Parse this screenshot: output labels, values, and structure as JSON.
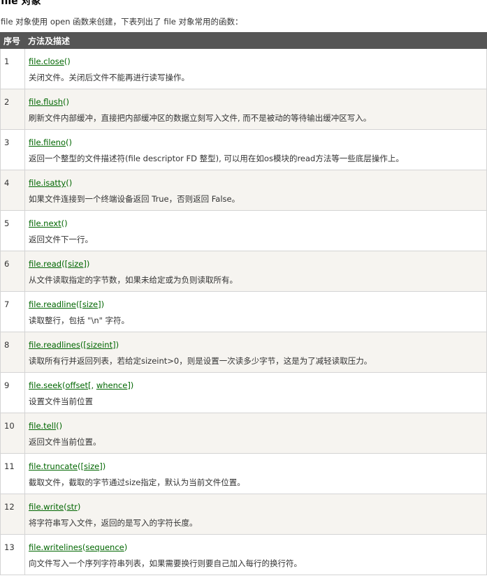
{
  "page": {
    "heading": "file 对象",
    "intro": "file 对象使用 open 函数来创建，下表列出了 file 对象常用的函数："
  },
  "table": {
    "headers": [
      "序号",
      "方法及描述"
    ],
    "rows": [
      {
        "num": "1",
        "parts": [
          {
            "t": "file.close",
            "u": true
          },
          {
            "t": "()",
            "u": false
          }
        ],
        "desc": "关闭文件。关闭后文件不能再进行读写操作。"
      },
      {
        "num": "2",
        "parts": [
          {
            "t": "file.flush",
            "u": true
          },
          {
            "t": "()",
            "u": false
          }
        ],
        "desc": "刷新文件内部缓冲，直接把内部缓冲区的数据立刻写入文件, 而不是被动的等待输出缓冲区写入。"
      },
      {
        "num": "3",
        "parts": [
          {
            "t": "file.fileno",
            "u": true
          },
          {
            "t": "()",
            "u": false
          }
        ],
        "desc": "返回一个整型的文件描述符(file descriptor FD 整型), 可以用在如os模块的read方法等一些底层操作上。"
      },
      {
        "num": "4",
        "parts": [
          {
            "t": "file.isatty",
            "u": true
          },
          {
            "t": "()",
            "u": false
          }
        ],
        "desc": "如果文件连接到一个终端设备返回 True，否则返回 False。"
      },
      {
        "num": "5",
        "parts": [
          {
            "t": "file.next",
            "u": true
          },
          {
            "t": "()",
            "u": false
          }
        ],
        "desc": "返回文件下一行。"
      },
      {
        "num": "6",
        "parts": [
          {
            "t": "file.read",
            "u": true
          },
          {
            "t": "([",
            "u": false
          },
          {
            "t": "size",
            "u": true
          },
          {
            "t": "])",
            "u": false
          }
        ],
        "desc": "从文件读取指定的字节数，如果未给定或为负则读取所有。"
      },
      {
        "num": "7",
        "parts": [
          {
            "t": "file.readline",
            "u": true
          },
          {
            "t": "([",
            "u": false
          },
          {
            "t": "size",
            "u": true
          },
          {
            "t": "])",
            "u": false
          }
        ],
        "desc": "读取整行，包括 \"\\n\" 字符。"
      },
      {
        "num": "8",
        "parts": [
          {
            "t": "file.readlines",
            "u": true
          },
          {
            "t": "([",
            "u": false
          },
          {
            "t": "sizeint",
            "u": true
          },
          {
            "t": "])",
            "u": false
          }
        ],
        "desc": "读取所有行并返回列表，若给定sizeint>0，则是设置一次读多少字节，这是为了减轻读取压力。"
      },
      {
        "num": "9",
        "parts": [
          {
            "t": "file.seek",
            "u": true
          },
          {
            "t": "(",
            "u": false
          },
          {
            "t": "offset",
            "u": true
          },
          {
            "t": "[, ",
            "u": false
          },
          {
            "t": "whence",
            "u": true
          },
          {
            "t": "])",
            "u": false
          }
        ],
        "desc": "设置文件当前位置"
      },
      {
        "num": "10",
        "parts": [
          {
            "t": "file.tell",
            "u": true
          },
          {
            "t": "()",
            "u": false
          }
        ],
        "desc": "返回文件当前位置。"
      },
      {
        "num": "11",
        "parts": [
          {
            "t": "file.truncate",
            "u": true
          },
          {
            "t": "([",
            "u": false
          },
          {
            "t": "size",
            "u": true
          },
          {
            "t": "])",
            "u": false
          }
        ],
        "desc": "截取文件，截取的字节通过size指定，默认为当前文件位置。"
      },
      {
        "num": "12",
        "parts": [
          {
            "t": "file.write",
            "u": true
          },
          {
            "t": "(",
            "u": false
          },
          {
            "t": "str",
            "u": true
          },
          {
            "t": ")",
            "u": false
          }
        ],
        "desc": "将字符串写入文件，返回的是写入的字符长度。"
      },
      {
        "num": "13",
        "parts": [
          {
            "t": "file.writelines",
            "u": true
          },
          {
            "t": "(",
            "u": false
          },
          {
            "t": "sequence",
            "u": true
          },
          {
            "t": ")",
            "u": false
          }
        ],
        "desc": "向文件写入一个序列字符串列表，如果需要换行则要自己加入每行的换行符。"
      }
    ]
  }
}
